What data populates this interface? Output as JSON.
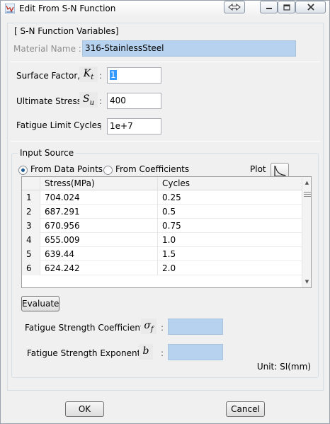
{
  "window": {
    "title": "Edit From S-N Function"
  },
  "variables": {
    "section_label": "[ S-N Function Variables]",
    "material_label": "Material Name :",
    "material_value": "316-StainlessSteel",
    "surface_label": "Surface Factor,",
    "surface_symbol": "K",
    "surface_symbol_sub": "t",
    "surface_value": "1",
    "ultimate_label": "Ultimate Stress,",
    "ultimate_symbol": "S",
    "ultimate_symbol_sub": "u",
    "ultimate_value": "400",
    "fatigue_cycles_label": "Fatigue Limit Cycles",
    "fatigue_cycles_value": "1e+7",
    "colon": ":"
  },
  "input_source": {
    "title": "Input Source",
    "option_data_points": "From Data Points",
    "option_coefficients": "From Coefficients",
    "selected": "From Data Points",
    "plot_label": "Plot"
  },
  "table": {
    "columns": [
      "Stress(MPa)",
      "Cycles"
    ],
    "rows": [
      {
        "index": "1",
        "stress": "704.024",
        "cycles": "0.25"
      },
      {
        "index": "2",
        "stress": "687.291",
        "cycles": "0.5"
      },
      {
        "index": "3",
        "stress": "670.956",
        "cycles": "0.75"
      },
      {
        "index": "4",
        "stress": "655.009",
        "cycles": "1.0"
      },
      {
        "index": "5",
        "stress": "639.44",
        "cycles": "1.5"
      },
      {
        "index": "6",
        "stress": "624.242",
        "cycles": "2.0"
      }
    ]
  },
  "results": {
    "evaluate_label": "Evaluate",
    "coefficient_label": "Fatigue Strength Coefficient,",
    "coefficient_symbol": "σ",
    "coefficient_symbol_sub": "f",
    "coefficient_value": "",
    "exponent_label": "Fatigue Strength Exponent,",
    "exponent_symbol": "b",
    "exponent_value": "",
    "unit_label": "Unit: SI(mm)"
  },
  "footer": {
    "ok_label": "OK",
    "cancel_label": "Cancel"
  },
  "colors": {
    "highlight_field": "#b7d2ee",
    "selection": "#3399ff"
  }
}
